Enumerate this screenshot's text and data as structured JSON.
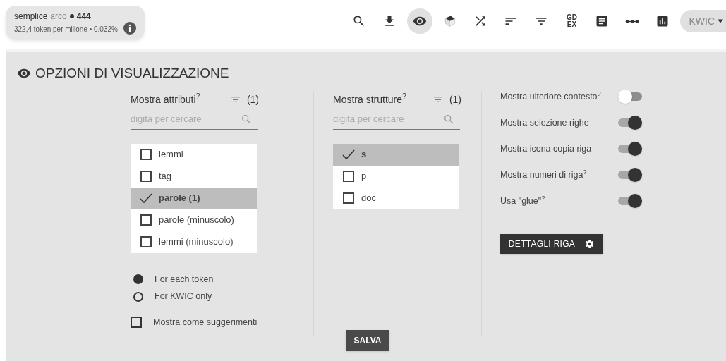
{
  "summary": {
    "query": "semplice",
    "term": "arco",
    "count": "444",
    "detail": "322,4 token per milione • 0.032%"
  },
  "toolbar": [
    {
      "kind": "refresh-search",
      "selected": false
    },
    {
      "kind": "download",
      "selected": false
    },
    {
      "kind": "eye",
      "selected": true
    },
    {
      "kind": "dice",
      "selected": false
    },
    {
      "kind": "shuffle",
      "selected": false
    },
    {
      "kind": "sort",
      "selected": false
    },
    {
      "kind": "filter",
      "selected": false
    },
    {
      "kind": "text",
      "label": "GD\nEX",
      "selected": false
    },
    {
      "kind": "doc",
      "selected": false
    },
    {
      "kind": "dots",
      "selected": false
    },
    {
      "kind": "chart",
      "selected": false
    }
  ],
  "view_menu": {
    "label": "KWIC"
  },
  "panel": {
    "title": "OPZIONI DI VISUALIZZAZIONE",
    "attributes": {
      "label": "Mostra attributi$^{?}$",
      "count": "(1)",
      "placeholder": "digita per cercare",
      "items": [
        {
          "label": "lemmi",
          "selected": false
        },
        {
          "label": "tag",
          "selected": false
        },
        {
          "label": "parole (1)",
          "selected": true
        },
        {
          "label": "parole (minuscolo)",
          "selected": false
        },
        {
          "label": "lemmi (minuscolo)",
          "selected": false
        }
      ],
      "modes": [
        {
          "label": "For each token",
          "selected": true
        },
        {
          "label": "For KWIC only",
          "selected": false
        }
      ],
      "hint_option": {
        "label": "Mostra come suggerimenti",
        "checked": false
      }
    },
    "structures": {
      "label": "Mostra strutture$^{?}$",
      "count": "(1)",
      "placeholder": "digita per cercare",
      "items": [
        {
          "label": "s",
          "selected": true
        },
        {
          "label": "p",
          "selected": false
        },
        {
          "label": "doc",
          "selected": false
        }
      ]
    },
    "toggles": [
      {
        "label": "Mostra ulteriore contesto$^{?}$",
        "on": false
      },
      {
        "label": "Mostra selezione righe",
        "on": true
      },
      {
        "label": "Mostra icona copia riga",
        "on": true
      },
      {
        "label": "Mostra numeri di riga$^{?}$",
        "on": true
      },
      {
        "label": "Usa \"glue\"$^{?}$",
        "on": true
      }
    ],
    "details_button": "DETTAGLI RIGA",
    "save_button": "SALVA"
  }
}
